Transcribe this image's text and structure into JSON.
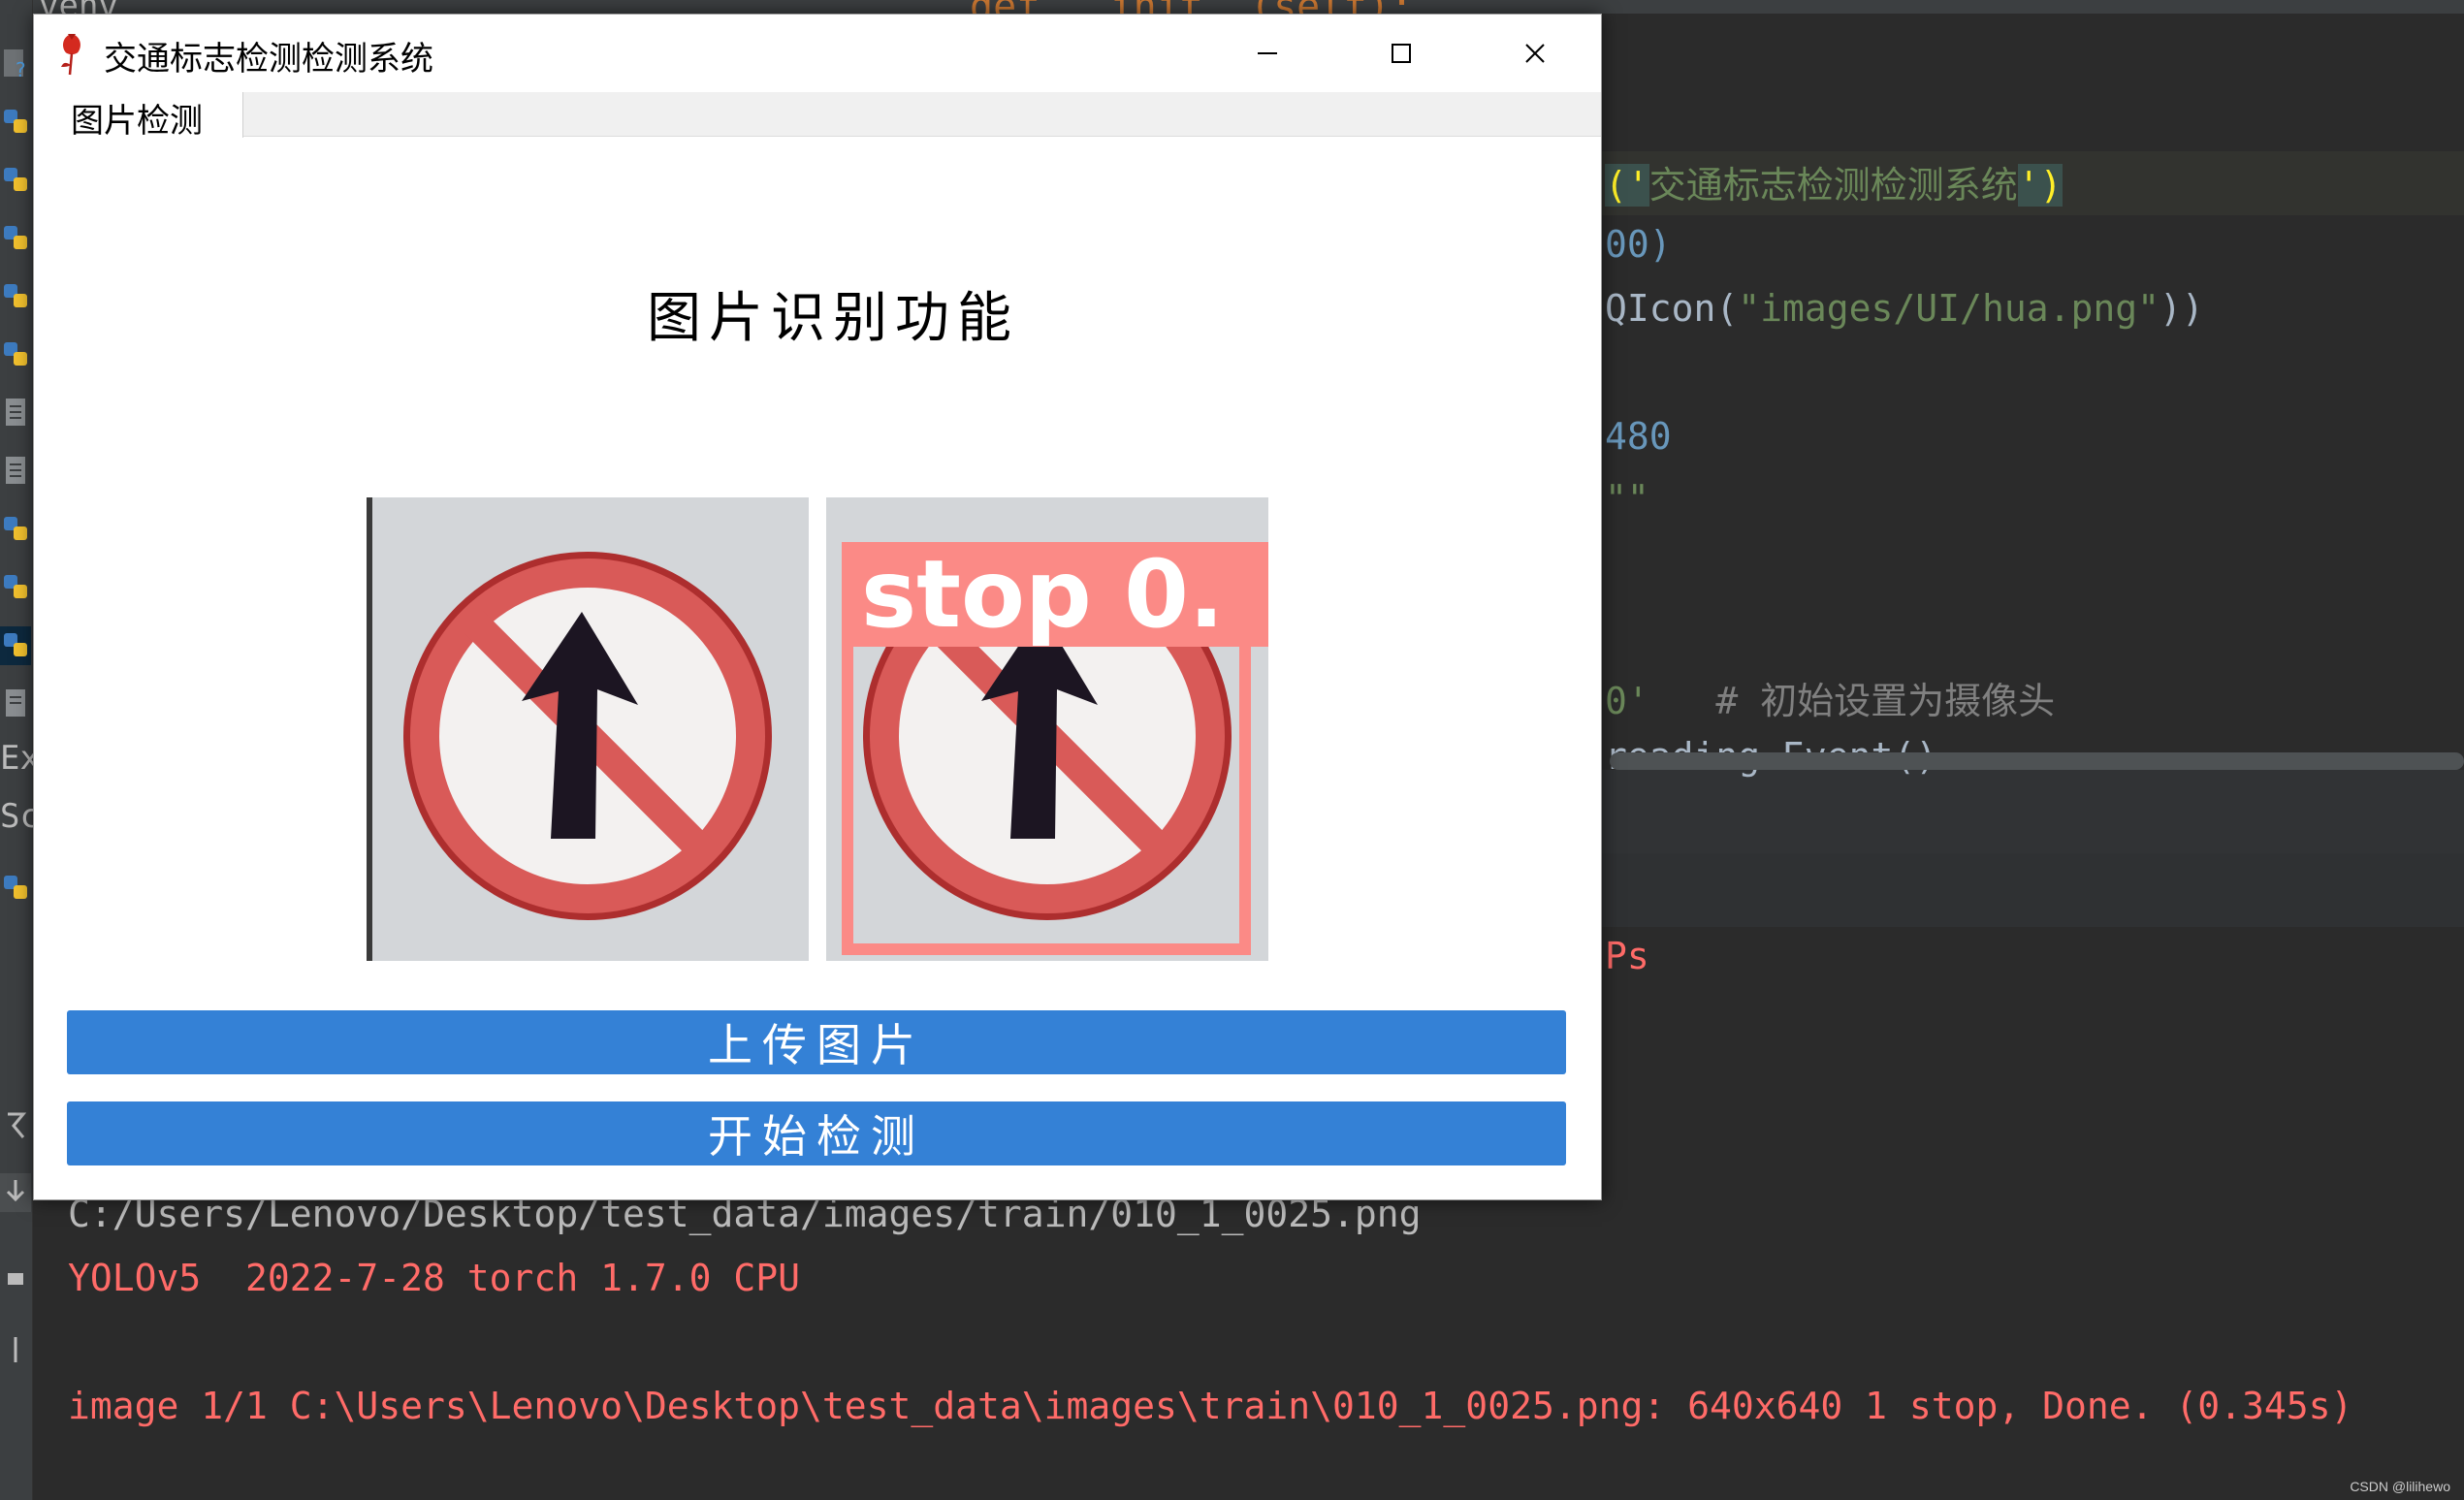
{
  "window": {
    "title": "交通标志检测检测系统"
  },
  "tabs": [
    {
      "label": "图片检测"
    }
  ],
  "main": {
    "heading": "图片识别功能",
    "detection_label": "stop 0.",
    "upload_button": "上传图片",
    "detect_button": "开始检测"
  },
  "ide": {
    "tab_venv": "venv",
    "top_code": "def __init__(self):",
    "gutter_labels": [
      "Ext",
      "Scr"
    ],
    "code": {
      "l1_open": "('",
      "l1_str": "交通标志检测检测系统",
      "l1_close": "')",
      "l2": "00)",
      "l3_prefix": "QIcon(",
      "l3_str": "\"images/UI/hua.png\"",
      "l3_suffix": "))",
      "l4": "480",
      "l5": "\"\"",
      "l6_str": "0'",
      "l6_comment": "# 初始设置为摄像头",
      "l7": "reading.Event()",
      "l8": "Ps"
    },
    "console": {
      "line1": "C:/Users/Lenovo/Desktop/test_data/images/train/010_1_0025.png",
      "line2": "YOLOv5  2022-7-28 torch 1.7.0 CPU",
      "line3": "image 1/1 C:\\Users\\Lenovo\\Desktop\\test_data\\images\\train\\010_1_0025.png: 640x640 1 stop, Done. (0.345s)"
    },
    "watermark": "CSDN @lilihewo"
  }
}
